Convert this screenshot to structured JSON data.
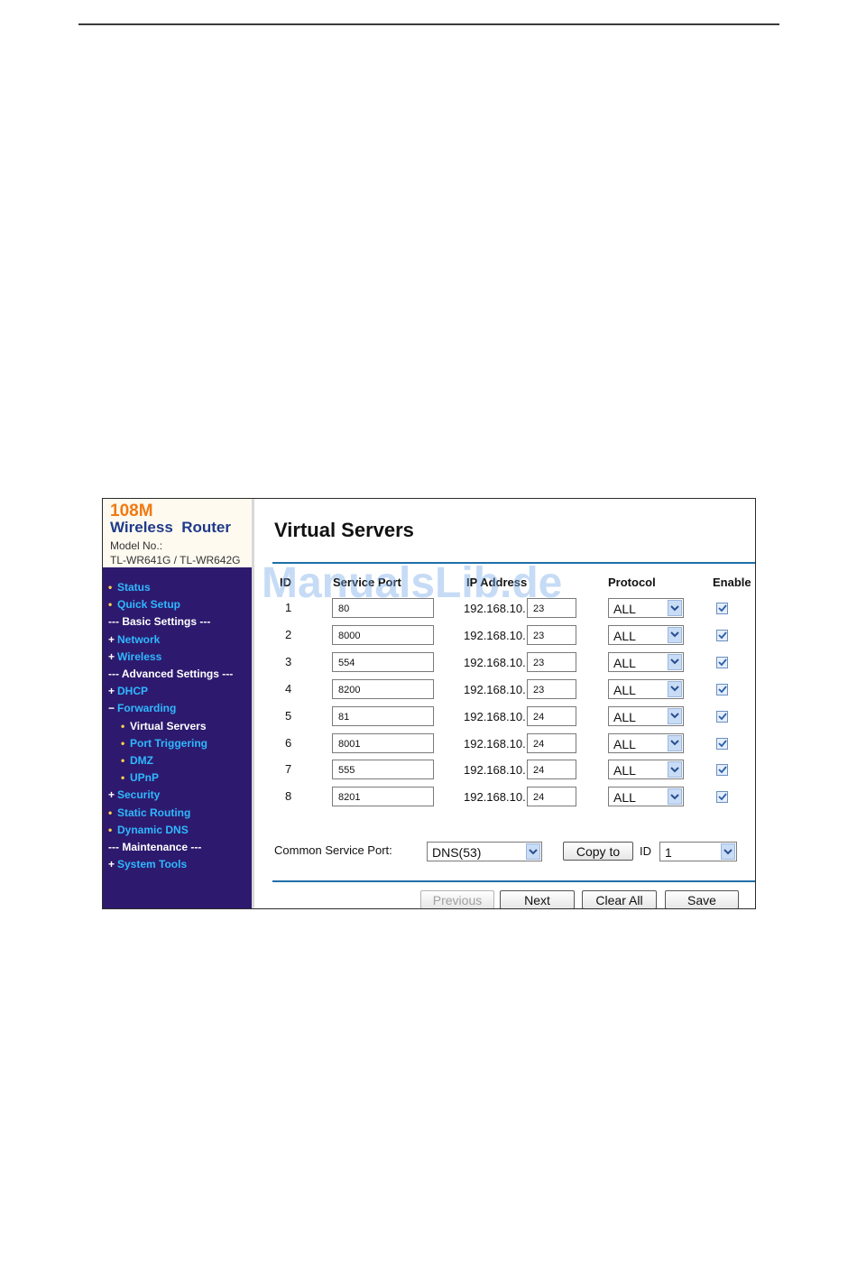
{
  "brand": {
    "speed": "108M",
    "name": "Wireless  Router",
    "model_label": "Model No.:",
    "model": "TL-WR641G / TL-WR642G"
  },
  "nav": [
    {
      "label": "Status",
      "kind": "link",
      "marker": "•"
    },
    {
      "label": "Quick Setup",
      "kind": "link",
      "marker": "•"
    },
    {
      "label": "--- Basic Settings ---",
      "kind": "header",
      "marker": ""
    },
    {
      "label": "Network",
      "kind": "link",
      "marker": "+"
    },
    {
      "label": "Wireless",
      "kind": "link",
      "marker": "+"
    },
    {
      "label": "--- Advanced Settings ---",
      "kind": "header",
      "marker": ""
    },
    {
      "label": "DHCP",
      "kind": "link",
      "marker": "+"
    },
    {
      "label": "Forwarding",
      "kind": "link",
      "marker": "−"
    },
    {
      "label": "Virtual Servers",
      "kind": "sub-active",
      "marker": "•"
    },
    {
      "label": "Port Triggering",
      "kind": "sub",
      "marker": "•"
    },
    {
      "label": "DMZ",
      "kind": "sub",
      "marker": "•"
    },
    {
      "label": "UPnP",
      "kind": "sub",
      "marker": "•"
    },
    {
      "label": "Security",
      "kind": "link",
      "marker": "+"
    },
    {
      "label": "Static Routing",
      "kind": "link",
      "marker": "•"
    },
    {
      "label": "Dynamic DNS",
      "kind": "link",
      "marker": "•"
    },
    {
      "label": "--- Maintenance ---",
      "kind": "header",
      "marker": ""
    },
    {
      "label": "System Tools",
      "kind": "link",
      "marker": "+"
    }
  ],
  "page": {
    "title": "Virtual Servers"
  },
  "table": {
    "headers": {
      "id": "ID",
      "service_port": "Service Port",
      "ip_address": "IP Address",
      "protocol": "Protocol",
      "enable": "Enable"
    },
    "ip_prefix": "192.168.10.",
    "rows": [
      {
        "id": "1",
        "service_port": "80",
        "ip_suffix": "23",
        "protocol": "ALL",
        "enabled": true
      },
      {
        "id": "2",
        "service_port": "8000",
        "ip_suffix": "23",
        "protocol": "ALL",
        "enabled": true
      },
      {
        "id": "3",
        "service_port": "554",
        "ip_suffix": "23",
        "protocol": "ALL",
        "enabled": true
      },
      {
        "id": "4",
        "service_port": "8200",
        "ip_suffix": "23",
        "protocol": "ALL",
        "enabled": true
      },
      {
        "id": "5",
        "service_port": "81",
        "ip_suffix": "24",
        "protocol": "ALL",
        "enabled": true
      },
      {
        "id": "6",
        "service_port": "8001",
        "ip_suffix": "24",
        "protocol": "ALL",
        "enabled": true
      },
      {
        "id": "7",
        "service_port": "555",
        "ip_suffix": "24",
        "protocol": "ALL",
        "enabled": true
      },
      {
        "id": "8",
        "service_port": "8201",
        "ip_suffix": "24",
        "protocol": "ALL",
        "enabled": true
      }
    ]
  },
  "common_service": {
    "label": "Common Service Port:",
    "selected": "DNS(53)",
    "copy_button": "Copy to",
    "id_label": "ID",
    "id_selected": "1"
  },
  "footer_buttons": {
    "previous": "Previous",
    "next": "Next",
    "clear_all": "Clear All",
    "save": "Save"
  },
  "watermark": "ManualsLib.de",
  "colors": {
    "nav_background": "#2d1a6e",
    "nav_link": "#2fb8ff",
    "brand_speed": "#f07a12",
    "brand_name": "#1e3a8a",
    "rule": "#1f6fa8"
  }
}
